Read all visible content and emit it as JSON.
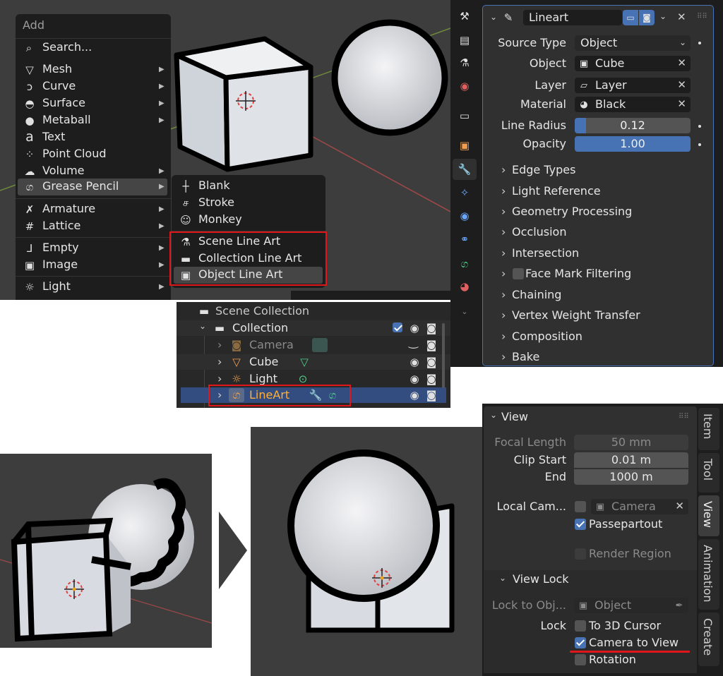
{
  "add_menu": {
    "title": "Add",
    "search": "Search...",
    "items": [
      {
        "label": "Mesh",
        "icon": "mesh-icon",
        "glyph": "▽"
      },
      {
        "label": "Curve",
        "icon": "curve-icon",
        "glyph": "ↄ"
      },
      {
        "label": "Surface",
        "icon": "surface-icon",
        "glyph": "◓"
      },
      {
        "label": "Metaball",
        "icon": "metaball-icon",
        "glyph": "●"
      },
      {
        "label": "Text",
        "icon": "text-icon",
        "glyph": "a"
      },
      {
        "label": "Point Cloud",
        "icon": "point-cloud-icon",
        "glyph": "⁘"
      },
      {
        "label": "Volume",
        "icon": "volume-icon",
        "glyph": "☁"
      },
      {
        "label": "Grease Pencil",
        "icon": "grease-pencil-icon",
        "glyph": "ග"
      },
      {
        "label": "Armature",
        "icon": "armature-icon",
        "glyph": "✗"
      },
      {
        "label": "Lattice",
        "icon": "lattice-icon",
        "glyph": "#"
      },
      {
        "label": "Empty",
        "icon": "empty-icon",
        "glyph": "⅃"
      },
      {
        "label": "Image",
        "icon": "image-icon",
        "glyph": "▣"
      },
      {
        "label": "Light",
        "icon": "light-icon",
        "glyph": "☼"
      }
    ]
  },
  "gp_submenu": {
    "items": [
      {
        "label": "Blank",
        "icon": "blank-icon",
        "glyph": "┼"
      },
      {
        "label": "Stroke",
        "icon": "stroke-icon",
        "glyph": "ச"
      },
      {
        "label": "Monkey",
        "icon": "monkey-icon",
        "glyph": "☺"
      },
      {
        "label": "Scene Line Art",
        "icon": "scene-line-art-icon",
        "glyph": "⚗"
      },
      {
        "label": "Collection Line Art",
        "icon": "collection-line-art-icon",
        "glyph": "▬"
      },
      {
        "label": "Object Line Art",
        "icon": "object-line-art-icon",
        "glyph": "▣"
      }
    ]
  },
  "modifier_panel": {
    "name": "Lineart",
    "source_type_label": "Source Type",
    "source_type_value": "Object",
    "object_label": "Object",
    "object_value": "Cube",
    "layer_label": "Layer",
    "layer_value": "Layer",
    "material_label": "Material",
    "material_value": "Black",
    "line_radius_label": "Line Radius",
    "line_radius_value": "0.12",
    "line_radius_fraction": 0.1,
    "opacity_label": "Opacity",
    "opacity_value": "1.00",
    "opacity_fraction": 1.0,
    "sections": [
      "Edge Types",
      "Light Reference",
      "Geometry Processing",
      "Occlusion",
      "Intersection",
      "Face Mark Filtering",
      "Chaining",
      "Vertex Weight Transfer",
      "Composition",
      "Bake"
    ]
  },
  "outliner": {
    "scene_collection": "Scene Collection",
    "collection": "Collection",
    "rows": [
      {
        "label": "Camera",
        "icon": "camera-icon",
        "glyph": "🎥",
        "dim": true
      },
      {
        "label": "Cube",
        "icon": "cube-icon",
        "glyph": "▽"
      },
      {
        "label": "Light",
        "icon": "light-icon",
        "glyph": "☼"
      },
      {
        "label": "LineArt",
        "icon": "lineart-icon",
        "glyph": "ග",
        "selected": true
      }
    ]
  },
  "view_panel": {
    "title": "View",
    "focal_length_label": "Focal Length",
    "focal_length_value": "50 mm",
    "clip_start_label": "Clip Start",
    "clip_start_value": "0.01 m",
    "end_label": "End",
    "end_value": "1000 m",
    "local_cam_label": "Local Cam...",
    "local_cam_value": "Camera",
    "passepartout": "Passepartout",
    "render_region": "Render Region",
    "view_lock_title": "View Lock",
    "lock_to_obj_label": "Lock to Obj...",
    "lock_to_obj_value": "Object",
    "lock_label": "Lock",
    "to_3d_cursor": "To 3D Cursor",
    "camera_to_view": "Camera to View",
    "rotation": "Rotation",
    "tabs": [
      "Item",
      "Tool",
      "View",
      "Animation",
      "Create"
    ]
  },
  "colors": {
    "menu_bg": "#1d1d1d",
    "panel_bg": "#303030",
    "accent": "#4772b3",
    "highlight": "#e0161b",
    "viewport": "#3d3d3d"
  }
}
